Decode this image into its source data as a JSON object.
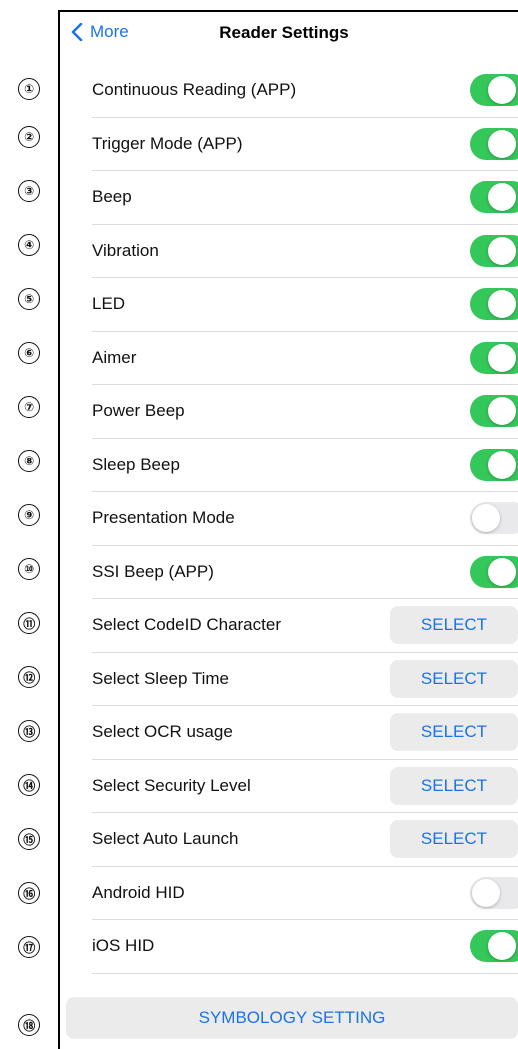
{
  "nav": {
    "back_label": "More",
    "title": "Reader Settings"
  },
  "markers": [
    "①",
    "②",
    "③",
    "④",
    "⑤",
    "⑥",
    "⑦",
    "⑧",
    "⑨",
    "⑩",
    "⑪",
    "⑫",
    "⑬",
    "⑭",
    "⑮",
    "⑯",
    "⑰",
    "⑱"
  ],
  "settings": [
    {
      "label": "Continuous Reading (APP)",
      "control": "toggle",
      "on": true
    },
    {
      "label": "Trigger Mode (APP)",
      "control": "toggle",
      "on": true
    },
    {
      "label": "Beep",
      "control": "toggle",
      "on": true
    },
    {
      "label": "Vibration",
      "control": "toggle",
      "on": true
    },
    {
      "label": "LED",
      "control": "toggle",
      "on": true
    },
    {
      "label": "Aimer",
      "control": "toggle",
      "on": true
    },
    {
      "label": "Power Beep",
      "control": "toggle",
      "on": true
    },
    {
      "label": "Sleep Beep",
      "control": "toggle",
      "on": true
    },
    {
      "label": "Presentation Mode",
      "control": "toggle",
      "on": false
    },
    {
      "label": "SSI Beep (APP)",
      "control": "toggle",
      "on": true
    },
    {
      "label": "Select CodeID Character",
      "control": "button",
      "button_label": "SELECT"
    },
    {
      "label": "Select Sleep Time",
      "control": "button",
      "button_label": "SELECT"
    },
    {
      "label": "Select OCR usage",
      "control": "button",
      "button_label": "SELECT"
    },
    {
      "label": "Select Security Level",
      "control": "button",
      "button_label": "SELECT"
    },
    {
      "label": "Select Auto Launch",
      "control": "button",
      "button_label": "SELECT"
    },
    {
      "label": "Android HID",
      "control": "toggle",
      "on": false
    },
    {
      "label": "iOS HID",
      "control": "toggle",
      "on": true
    }
  ],
  "symbology_button": "SYMBOLOGY SETTING",
  "colors": {
    "accent": "#1a73e8",
    "toggle_on": "#34c759",
    "toggle_off": "#e9e9eb"
  },
  "icons": {
    "back": "chevron-left-icon"
  }
}
